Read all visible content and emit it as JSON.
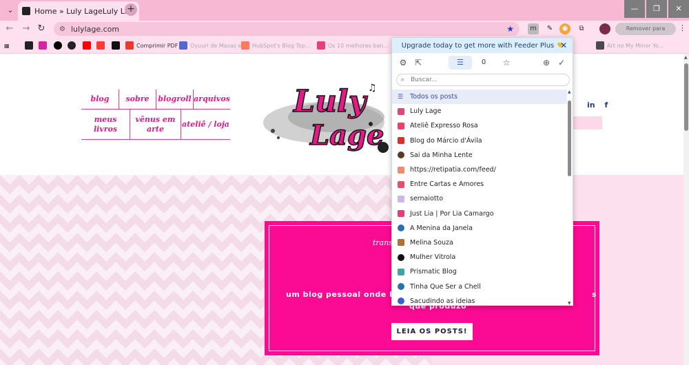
{
  "browser": {
    "tab_title": "Home » Luly LageLuly Lage",
    "url": "lulylage.com",
    "reload_extension_label": "Remover para atualizar",
    "bookmarks": [
      {
        "label": "",
        "color": "#222222"
      },
      {
        "label": "",
        "color": "#d6249f"
      },
      {
        "label": "",
        "color": "#000000"
      },
      {
        "label": "",
        "color": "#222222"
      },
      {
        "label": "",
        "color": "#ff0000"
      },
      {
        "label": "",
        "color": "#ff3b30"
      },
      {
        "label": "",
        "color": "#111111"
      },
      {
        "label": "Comprimir PDF",
        "color": "#e33b2e"
      },
      {
        "label": "Oyuuri de Masas e...",
        "color": "#5566cc"
      },
      {
        "label": "HubSpot's Blog Top...",
        "color": "#ff7a59"
      },
      {
        "label": "Os 10 melhores ban...",
        "color": "#e8407a"
      },
      {
        "label": "Art no My Minor Yo...",
        "color": "#4a4a4a"
      }
    ]
  },
  "site": {
    "nav": [
      [
        "blog",
        "sobre",
        "blogroll",
        "arquivos"
      ],
      [
        "meus livros",
        "vênus em arte",
        "ateliê / loja"
      ]
    ],
    "social": {
      "linkedin": "in",
      "facebook": "f"
    },
    "hero": {
      "kicker": "transf",
      "tagline": "um blog pessoal onde há 21",
      "tagline_tail": "s",
      "tagline2": "que produzo",
      "cta": "LEIA OS POSTS!"
    }
  },
  "feeder": {
    "promo": "Upgrade today to get more with Feeder Plus",
    "count": "0",
    "search_placeholder": "Buscar...",
    "all_label": "Todos os posts",
    "feeds": [
      {
        "name": "Luly Lage",
        "color": "#e0457b"
      },
      {
        "name": "Ateliê Expresso Rosa",
        "color": "#f0406a"
      },
      {
        "name": "Blog do Márcio d'Ávila",
        "color": "#d9302a"
      },
      {
        "name": "Sai da Minha Lente",
        "color": "#5a3a22"
      },
      {
        "name": "https://retipatia.com/feed/",
        "color": "#f28b6b"
      },
      {
        "name": "Entre Cartas e Amores",
        "color": "#e8506a"
      },
      {
        "name": "sernaiotto",
        "color": "#c9b8e8"
      },
      {
        "name": "Just Lia | Por Lia Camargo",
        "color": "#e0407a"
      },
      {
        "name": "A Menina da Janela",
        "color": "#2a6fb0"
      },
      {
        "name": "Melina Souza",
        "color": "#b0703a"
      },
      {
        "name": "Mulher Vitrola",
        "color": "#111111"
      },
      {
        "name": "Prismatic Blog",
        "color": "#3aa8a0"
      },
      {
        "name": "Tinha Que Ser a Chell",
        "color": "#2a6fb0"
      },
      {
        "name": "Sacudindo as ideias",
        "color": "#3d5fd0"
      }
    ]
  }
}
